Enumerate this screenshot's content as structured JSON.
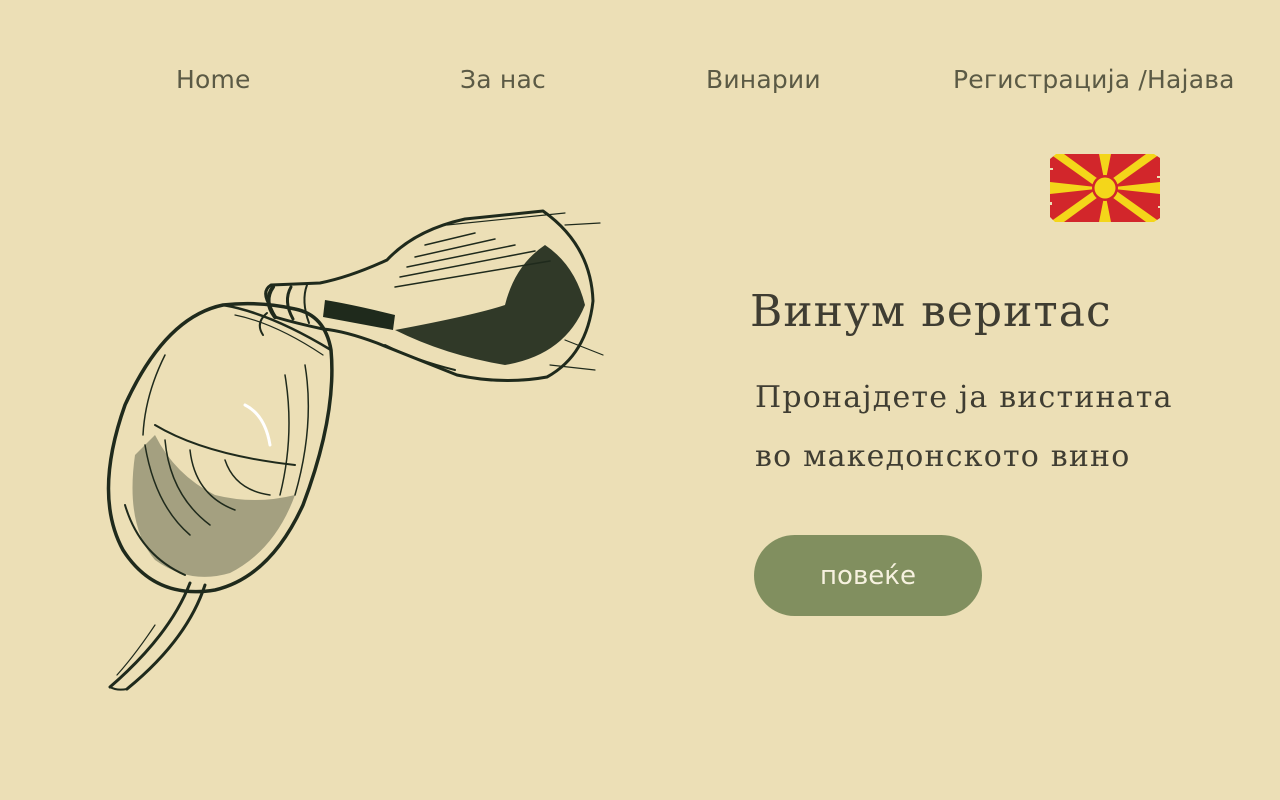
{
  "nav": {
    "home": "Home",
    "about": "За нас",
    "wineries": "Винарии",
    "auth": "Регистрација /Најава"
  },
  "language": {
    "flag_icon": "macedonia-flag-icon",
    "colors": {
      "field": "#d2262b",
      "sun": "#f4d61a"
    }
  },
  "illustration": {
    "icon": "wine-bottle-pouring-into-glass-icon",
    "ink_color": "#1f2a1c"
  },
  "hero": {
    "title": "Винум веритас",
    "line1": "Пронајдете ја вистината",
    "line2": "во македонското вино",
    "button_label": "повеќе"
  },
  "theme": {
    "background": "#ecdfb6",
    "text": "#3f3d32",
    "nav_text": "#5b5a45",
    "accent": "#818f5f"
  }
}
